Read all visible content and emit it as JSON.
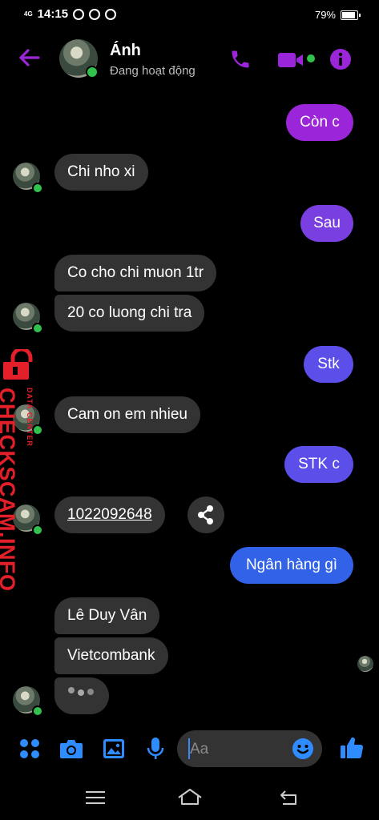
{
  "status_bar": {
    "network": "4G",
    "time": "14:15",
    "battery": "79%"
  },
  "header": {
    "contact_name": "Ánh",
    "status": "Đang hoạt động"
  },
  "messages": [
    {
      "side": "out",
      "text": "Còn c"
    },
    {
      "side": "in",
      "text": "Chi nho xi"
    },
    {
      "side": "out",
      "text": "Sau"
    },
    {
      "side": "in",
      "text": "Co cho chi muon 1tr"
    },
    {
      "side": "in",
      "text": "20  co luong chi tra"
    },
    {
      "side": "out",
      "text": "Stk"
    },
    {
      "side": "in",
      "text": "Cam on em nhieu"
    },
    {
      "side": "out",
      "text": "STK c"
    },
    {
      "side": "in",
      "text": "1022092648"
    },
    {
      "side": "out",
      "text": "Ngân hàng gì"
    },
    {
      "side": "in",
      "text": "Lê Duy Vân"
    },
    {
      "side": "in",
      "text": "Vietcombank"
    }
  ],
  "composer": {
    "placeholder": "Aa"
  },
  "watermark": {
    "text": "CHECKSCAM.INFO",
    "subtext": "DATA CENTER"
  },
  "colors": {
    "accent": "#9b26d9",
    "online": "#31c24d",
    "incoming": "#333334",
    "icon_blue": "#2f8cff"
  }
}
